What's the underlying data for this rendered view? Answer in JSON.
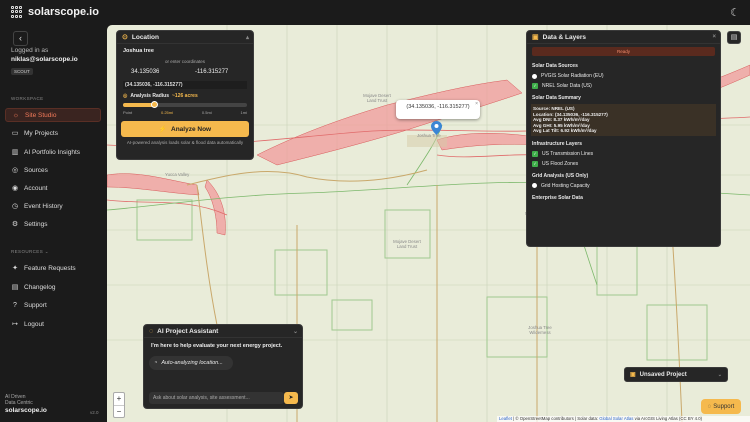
{
  "app": {
    "title": "solarscope.io"
  },
  "sidebar": {
    "logged_in_label": "Logged in as",
    "email": "niklas@solarscope.io",
    "plan": "SCOUT",
    "workspace_label": "WORKSPACE",
    "resources_label": "RESOURCES",
    "items": [
      {
        "label": "Site Studio",
        "icon": "sun-icon"
      },
      {
        "label": "My Projects",
        "icon": "folder-icon"
      },
      {
        "label": "AI Portfolio Insights",
        "icon": "chart-icon"
      },
      {
        "label": "Sources",
        "icon": "database-icon"
      },
      {
        "label": "Account",
        "icon": "user-icon"
      },
      {
        "label": "Event History",
        "icon": "history-icon"
      },
      {
        "label": "Settings",
        "icon": "gear-icon"
      }
    ],
    "resources": [
      {
        "label": "Feature Requests",
        "icon": "sparkle-icon"
      },
      {
        "label": "Changelog",
        "icon": "book-icon"
      },
      {
        "label": "Support",
        "icon": "help-icon"
      },
      {
        "label": "Logout",
        "icon": "logout-icon"
      }
    ],
    "footer_line1": "AI Driven",
    "footer_line2": "Data Centric",
    "footer_brand": "solarscope.io",
    "version": "v2.0"
  },
  "location": {
    "title": "Location",
    "place": "Joshua tree",
    "or_text": "or enter coordinates",
    "lat": "34.135036",
    "lng": "-116.315277",
    "coord_pair": "(34.135036, -116.315277)",
    "radius_label": "Analysis Radius",
    "radius_value": "~126 acres",
    "tick_point": "Point",
    "tick_current": "0.25mi",
    "tick_mid": "0.5mi",
    "tick_max": "1mi",
    "radius_fraction": 0.25,
    "analyze_label": "Analyze Now",
    "note": "AI-powered analysis loads solar & flood data automatically"
  },
  "data_layers": {
    "title": "Data & Layers",
    "status": "Ready",
    "solar_sources_heading": "Solar Data Sources",
    "opt_pvgis": "PVGIS Solar Radiation (EU)",
    "opt_nrel": "NREL Solar Data (US)",
    "summary_heading": "Solar Data Summary",
    "summary": [
      "Source: NREL (US)",
      "Location: (34.135036, -116.315277)",
      "Avg DNI: 8.37 kWh/m²/day",
      "Avg GHI: 5.95 kWh/m²/day",
      "Avg Lat Tilt: 6.92 kWh/m²/day"
    ],
    "infra_heading": "Infrastructure Layers",
    "opt_transmission": "US Transmission Lines",
    "opt_flood": "US Flood Zones",
    "grid_heading": "Grid Analysis (US Only)",
    "opt_hosting": "Grid Hosting Capacity",
    "enterprise_heading": "Enterprise Solar Data"
  },
  "ai": {
    "title": "AI Project Assistant",
    "message": "I'm here to help evaluate your next energy project.",
    "status": "Auto-analyzing location...",
    "placeholder": "Ask about solar analysis, site assessment..."
  },
  "map": {
    "popup_text": "(34.135036, -116.315277)",
    "labels": {
      "yucca": "Yucca Valley",
      "jt": "Joshua Tree",
      "mojave": "Mojave Desert Land Trust",
      "wilderness": "Joshua Tree Wilderness"
    },
    "attribution_leaflet": "Leaflet",
    "attribution_rest": " | © OpenStreetMap contributors | Solar data: ",
    "attribution_link": "Global Solar Atlas",
    "attribution_tail": " via ArcGIS Living Atlas (CC BY 4.0)"
  },
  "unsaved": {
    "title": "Unsaved Project"
  },
  "support": {
    "label": "Support"
  },
  "colors": {
    "accent": "#f5b94d",
    "active": "#f47a5a",
    "flood": "#e57373",
    "green": "#3fae4a"
  }
}
